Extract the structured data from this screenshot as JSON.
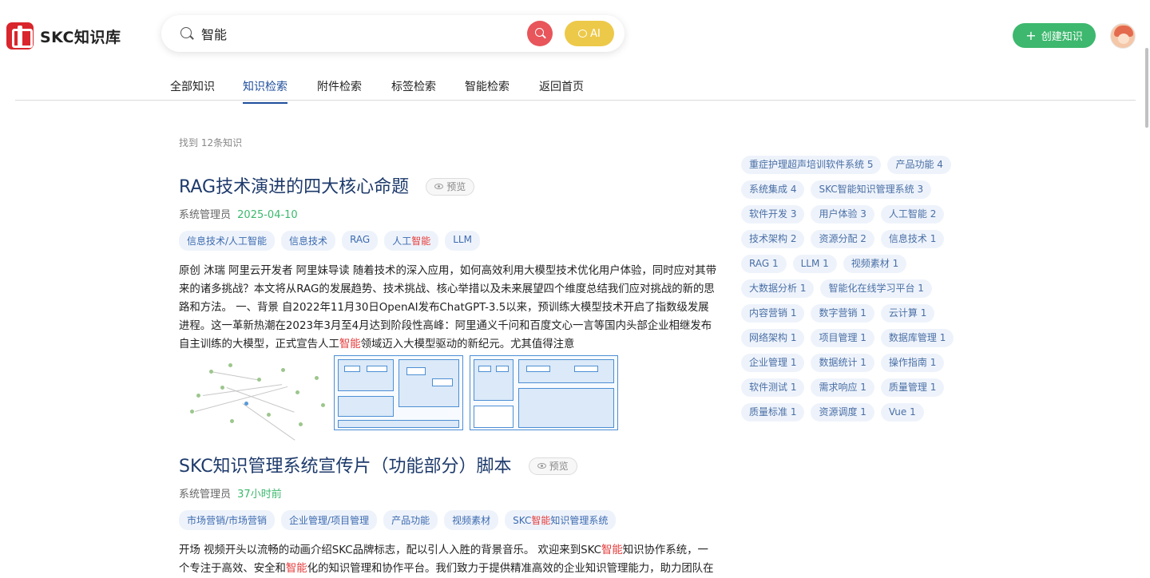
{
  "brand": {
    "name": "SKC知识库"
  },
  "search": {
    "value": "智能",
    "ai_label": "AI"
  },
  "header": {
    "create_label": "创建知识"
  },
  "nav": {
    "items": [
      {
        "label": "全部知识"
      },
      {
        "label": "知识检索"
      },
      {
        "label": "附件检索"
      },
      {
        "label": "标签检索"
      },
      {
        "label": "智能检索"
      },
      {
        "label": "返回首页"
      }
    ],
    "active": "知识检索"
  },
  "results": {
    "count_text": "找到 12条知识"
  },
  "articles": [
    {
      "title": "RAG技术演进的四大核心命题",
      "preview_label": "预览",
      "author": "系统管理员",
      "date": "2025-04-10",
      "tags": [
        "信息技术/人工智能",
        "信息技术",
        "RAG",
        "人工智能",
        "LLM"
      ],
      "text_before": "原创 沐瑞 阿里云开发者 阿里妹导读 随着技术的深入应用，如何高效利用大模型技术优化用户体验，同时应对其带来的诸多挑战？本文将从RAG的发展趋势、技术挑战、核心举措以及未来展望四个维度总结我们应对挑战的新的思路和方法。 一、背景 自2022年11月30日OpenAI发布ChatGPT-3.5以来，预训练大模型技术开启了指数级发展进程。这一革新热潮在2023年3月至4月达到阶段性高峰：阿里通义千问和百度文心一言等国内头部企业相继发布自主训练的大模型，正式宣告人工",
      "text_highlight": "智能",
      "text_after": "领域迈入大模型驱动的新纪元。尤其值得注意"
    },
    {
      "title": "SKC知识管理系统宣传片（功能部分）脚本",
      "preview_label": "预览",
      "author": "系统管理员",
      "date": "37小时前",
      "tags": [
        "市场营销/市场营销",
        "企业管理/项目管理",
        "产品功能",
        "视频素材",
        "SKC智能知识管理系统"
      ],
      "text_1": "开场 视频开头以流畅的动画介绍SKC品牌标志，配以引人入胜的背景音乐。 欢迎来到SKC",
      "text_h1": "智能",
      "text_2": "知识协作系统，一个专注于高效、安全和",
      "text_h2": "智能",
      "text_3": "化的知识管理和协作平台。我们致力于提供精准高效的企业知识管理能力，助力团队在"
    }
  ],
  "tag_cloud": [
    "重症护理超声培训软件系统 5",
    "产品功能 4",
    "系统集成 4",
    "SKC智能知识管理系统 3",
    "软件开发 3",
    "用户体验 3",
    "人工智能 2",
    "技术架构 2",
    "资源分配 2",
    "信息技术 1",
    "RAG 1",
    "LLM 1",
    "视频素材 1",
    "大数据分析 1",
    "智能化在线学习平台 1",
    "内容营销 1",
    "数字营销 1",
    "云计算 1",
    "网络架构 1",
    "项目管理 1",
    "数据库管理 1",
    "企业管理 1",
    "数据统计 1",
    "操作指南 1",
    "软件测试 1",
    "需求响应 1",
    "质量管理 1",
    "质量标准 1",
    "资源调度 1",
    "Vue 1"
  ],
  "colors": {
    "primary": "#1f4e9c",
    "green": "#3db86e",
    "red": "#e53b3b",
    "ai": "#edc94a"
  }
}
